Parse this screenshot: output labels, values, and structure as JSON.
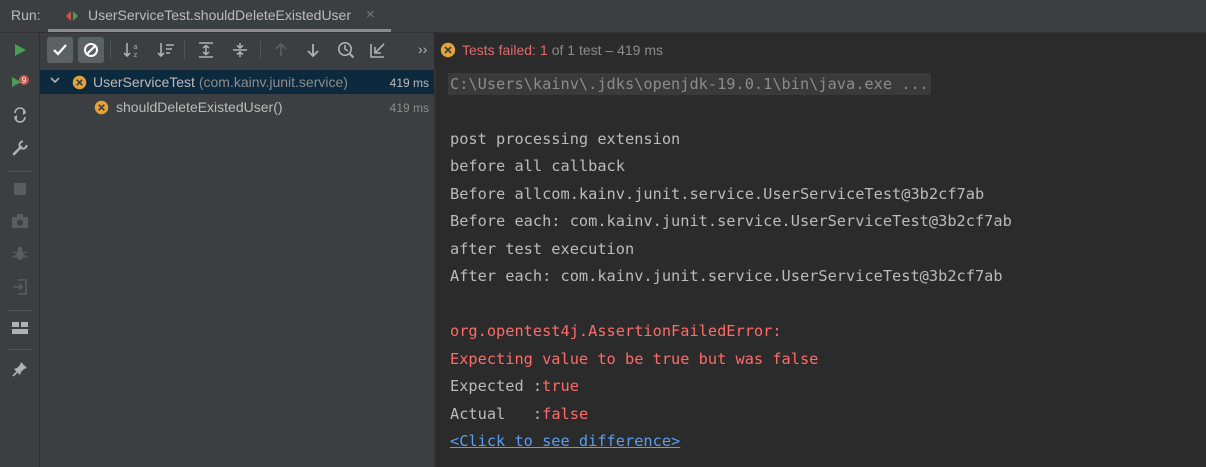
{
  "runbar": {
    "label": "Run:",
    "tab_title": "UserServiceTest.shouldDeleteExistedUser",
    "tab_close": "×"
  },
  "status": {
    "failed_label": "Tests failed:",
    "failed_count": "1",
    "rest": "of 1 test – 419 ms"
  },
  "toolbar": {
    "more": "››"
  },
  "tree": {
    "rows": [
      {
        "name": "UserServiceTest",
        "package": "(com.kainv.junit.service)",
        "time": "419 ms"
      },
      {
        "name": "shouldDeleteExistedUser()",
        "time": "419 ms"
      }
    ]
  },
  "console": {
    "command": "C:\\Users\\kainv\\.jdks\\openjdk-19.0.1\\bin\\java.exe ...",
    "lines": [
      "post processing extension",
      "before all callback",
      "Before allcom.kainv.junit.service.UserServiceTest@3b2cf7ab",
      "Before each: com.kainv.junit.service.UserServiceTest@3b2cf7ab",
      "after test execution",
      "After each: com.kainv.junit.service.UserServiceTest@3b2cf7ab"
    ],
    "error_class": "org.opentest4j.AssertionFailedError:",
    "error_message": "Expecting value to be true but was false",
    "expected_label": "Expected :",
    "expected_value": "true",
    "actual_label": "Actual   :",
    "actual_value": "false",
    "diff_link": "<Click to see difference>"
  },
  "colors": {
    "error": "#ff6b68",
    "fail_icon": "#e5a33b",
    "run_green": "#499c54",
    "link": "#589df6",
    "selection": "#0d293e"
  },
  "icons": {
    "left_toolbar": [
      "run-icon",
      "rerun-failed-icon",
      "toggle-auto-test-icon",
      "settings-wrench-icon",
      "stop-icon",
      "camera-icon",
      "debug-bug-icon",
      "exit-icon",
      "layout-icon",
      "pin-icon"
    ],
    "tree_toolbar": [
      "show-passed-icon",
      "show-ignored-icon",
      "sort-alphabetically-icon",
      "sort-by-duration-icon",
      "expand-all-icon",
      "collapse-all-icon",
      "previous-failed-icon",
      "next-failed-icon",
      "test-history-icon",
      "import-tests-icon"
    ]
  }
}
